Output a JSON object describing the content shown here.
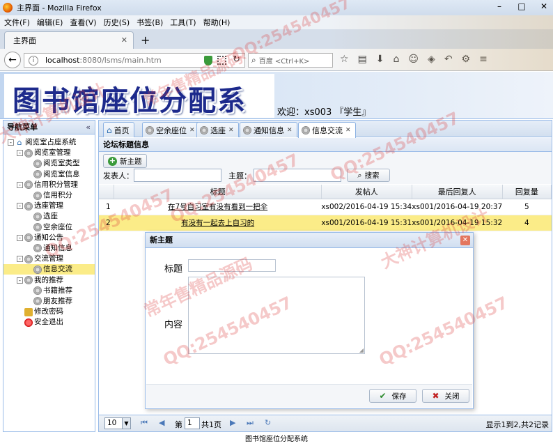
{
  "browser": {
    "window_title": "主界面 - Mozilla Firefox",
    "menu": [
      "文件(F)",
      "编辑(E)",
      "查看(V)",
      "历史(S)",
      "书签(B)",
      "工具(T)",
      "帮助(H)"
    ],
    "tab_title": "主界面",
    "url_host": "localhost",
    "url_rest": ":8080/lsms/main.htm",
    "search_placeholder": "百度 <Ctrl+K>"
  },
  "app": {
    "logo_text": "图书馆座位分配系统",
    "welcome": "欢迎：xs003 『学生』"
  },
  "sidebar": {
    "title": "导航菜单",
    "tree": [
      {
        "label": "阅览室占座系统",
        "level": 0,
        "icon": "home-icon",
        "expander": "-"
      },
      {
        "label": "阅览室管理",
        "level": 1,
        "icon": "gear-icon",
        "expander": "-"
      },
      {
        "label": "阅览室类型",
        "level": 2,
        "icon": "gear-icon"
      },
      {
        "label": "阅览室信息",
        "level": 2,
        "icon": "gear-icon"
      },
      {
        "label": "信用积分管理",
        "level": 1,
        "icon": "gear-icon",
        "expander": "-"
      },
      {
        "label": "信用积分",
        "level": 2,
        "icon": "gear-icon"
      },
      {
        "label": "选座管理",
        "level": 1,
        "icon": "gear-icon",
        "expander": "-"
      },
      {
        "label": "选座",
        "level": 2,
        "icon": "gear-icon"
      },
      {
        "label": "空余座位",
        "level": 2,
        "icon": "gear-icon"
      },
      {
        "label": "通知公告",
        "level": 1,
        "icon": "gear-icon",
        "expander": "-"
      },
      {
        "label": "通知信息",
        "level": 2,
        "icon": "gear-icon"
      },
      {
        "label": "交流管理",
        "level": 1,
        "icon": "gear-icon",
        "expander": "-"
      },
      {
        "label": "信息交流",
        "level": 2,
        "icon": "gear-icon",
        "selected": true
      },
      {
        "label": "我的推荐",
        "level": 1,
        "icon": "gear-icon",
        "expander": "-"
      },
      {
        "label": "书籍推荐",
        "level": 2,
        "icon": "gear-icon"
      },
      {
        "label": "朋友推荐",
        "level": 2,
        "icon": "gear-icon"
      },
      {
        "label": "修改密码",
        "level": 1,
        "icon": "key-icon"
      },
      {
        "label": "安全退出",
        "level": 1,
        "icon": "exit-icon"
      }
    ]
  },
  "tabs": [
    {
      "label": "首页",
      "closable": false
    },
    {
      "label": "空余座位",
      "closable": true
    },
    {
      "label": "选座",
      "closable": true
    },
    {
      "label": "通知信息",
      "closable": true
    },
    {
      "label": "信息交流",
      "closable": true,
      "active": true
    }
  ],
  "panel": {
    "title": "论坛标题信息",
    "new_button": "新主题",
    "poster_label": "发表人：",
    "subject_label": "主题：",
    "search_button": "搜索"
  },
  "grid": {
    "columns": [
      "标题",
      "发帖人",
      "最后回复人",
      "回复量"
    ],
    "rows": [
      {
        "no": "1",
        "title": "在7号自习室有没有看到一把伞",
        "poster": "xs002/2016-04-19 15:34",
        "last": "xs001/2016-04-19 20:37",
        "replies": "5"
      },
      {
        "no": "2",
        "title": "有没有一起去上自习的",
        "poster": "xs001/2016-04-19 15:31",
        "last": "xs001/2016-04-19 15:32",
        "replies": "4"
      }
    ]
  },
  "dialog": {
    "title": "新主题",
    "title_label": "标题",
    "content_label": "内容",
    "save_button": "保存",
    "close_button": "关闭"
  },
  "pager": {
    "page_size": "10",
    "page_prefix": "第",
    "page_value": "1",
    "page_total": "共1页",
    "summary": "显示1到2,共2记录"
  },
  "status_text": "图书馆座位分配系统",
  "watermarks": [
    "QQ:254540457",
    "常年售精品源码",
    "大神计算机设计"
  ]
}
